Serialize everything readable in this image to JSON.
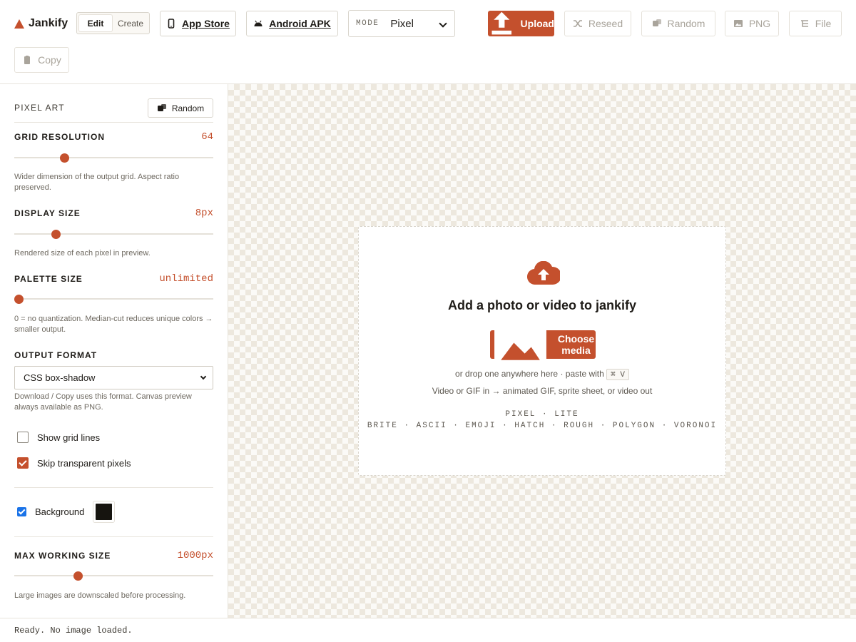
{
  "app": {
    "name": "Jankify"
  },
  "header": {
    "segment": {
      "edit": "Edit",
      "create": "Create"
    },
    "app_store": "App Store",
    "android_apk": "Android APK",
    "mode": {
      "label": "MODE",
      "value": "Pixel"
    },
    "upload": "Upload",
    "reseed": "Reseed",
    "random": "Random",
    "png": "PNG",
    "file": "File",
    "copy": "Copy"
  },
  "sidebar": {
    "section": "PIXEL ART",
    "random_button": "Random",
    "grid_resolution": {
      "label": "GRID RESOLUTION",
      "value": "64",
      "fraction": 0.24,
      "help": "Wider dimension of the output grid. Aspect ratio preserved."
    },
    "display_size": {
      "label": "DISPLAY SIZE",
      "value": "8px",
      "fraction": 0.195,
      "help": "Rendered size of each pixel in preview."
    },
    "palette_size": {
      "label": "PALETTE SIZE",
      "value": "unlimited",
      "fraction": 0.0,
      "help": "0 = no quantization. Median-cut reduces unique colors → smaller output."
    },
    "output_format": {
      "label": "OUTPUT FORMAT",
      "value": "CSS box-shadow",
      "help": "Download / Copy uses this format. Canvas preview always available as PNG."
    },
    "show_grid_lines": {
      "label": "Show grid lines",
      "checked": false
    },
    "skip_transparent": {
      "label": "Skip transparent pixels",
      "checked": true
    },
    "background": {
      "label": "Background",
      "checked": true,
      "color": "#16140f"
    },
    "max_working_size": {
      "label": "MAX WORKING SIZE",
      "value": "1000px",
      "fraction": 0.31,
      "help": "Large images are downscaled before processing."
    }
  },
  "canvas": {
    "title": "Add a photo or video to jankify",
    "choose_media": "Choose media",
    "drop_hint": "or drop one anywhere here · paste with",
    "kbd": "⌘ V",
    "video_hint": "Video or GIF in → animated GIF, sprite sheet, or video out",
    "modes_line1": "PIXEL · LITE",
    "modes_line2": "BRITE · ASCII · EMOJI · HATCH · ROUGH · POLYGON · VORONOI"
  },
  "status": "Ready. No image loaded.",
  "colors": {
    "accent": "#c4502d",
    "border": "#d9d5cc",
    "muted": "#6e6960"
  }
}
